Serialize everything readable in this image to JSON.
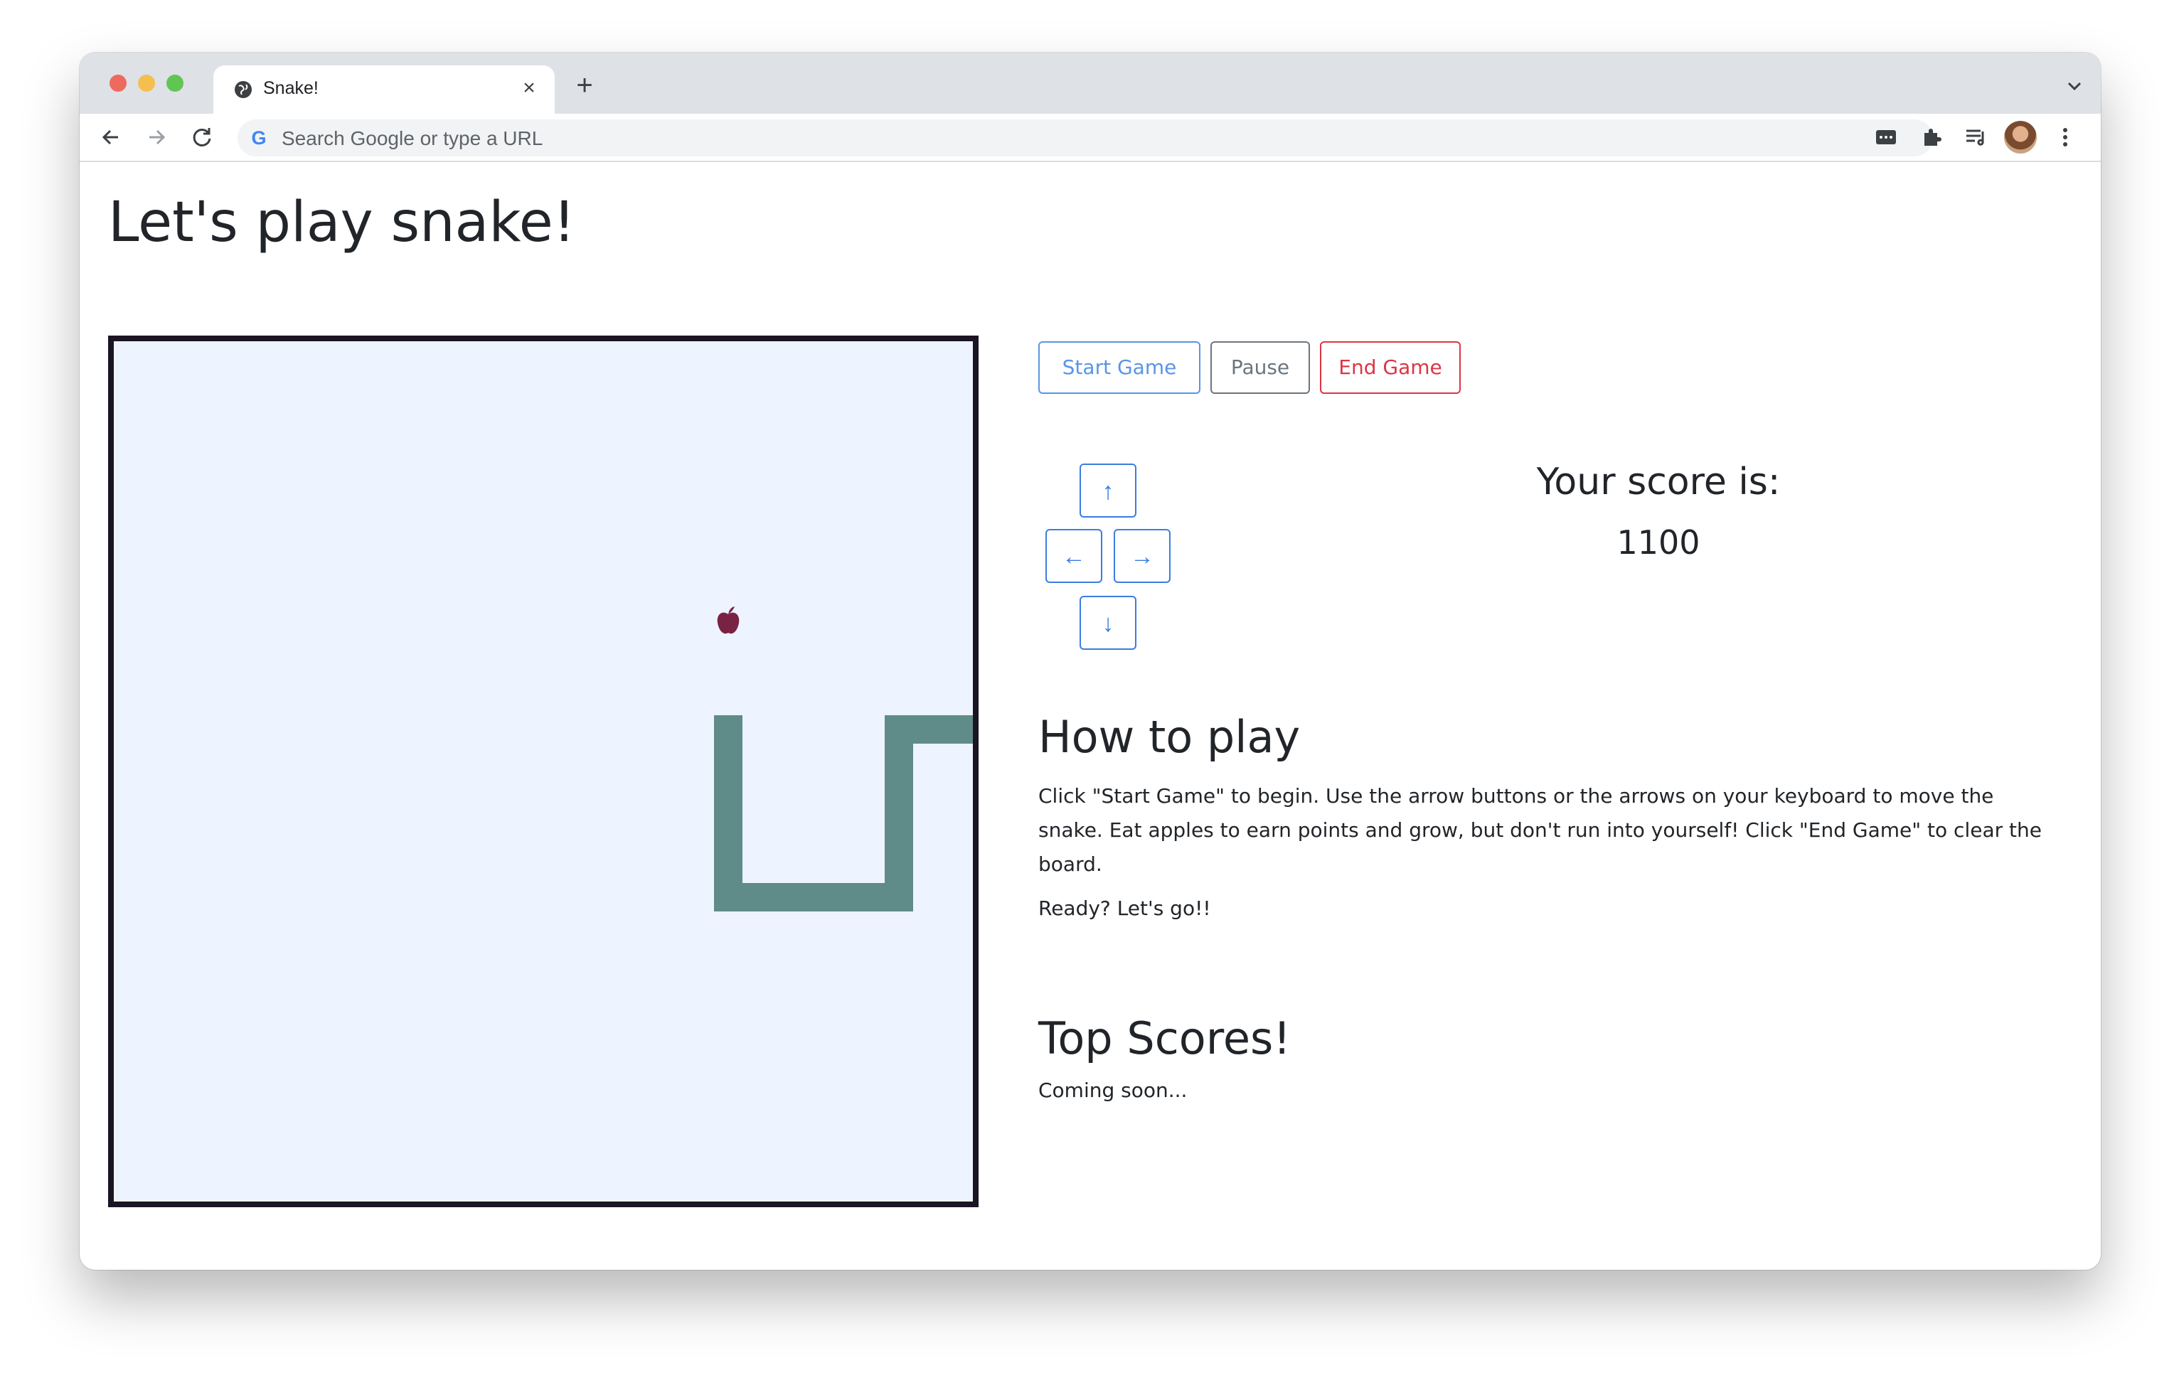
{
  "browser": {
    "tab_title": "Snake!",
    "tab_close": "×",
    "new_tab": "+",
    "address_placeholder": "Search Google or type a URL",
    "google_letter": "G",
    "icons": [
      "globe-icon",
      "close-icon",
      "plus-icon",
      "chevron-down-icon",
      "back-arrow-icon",
      "forward-arrow-icon",
      "reload-icon",
      "google-icon",
      "tab-media-icon",
      "extensions-puzzle-icon",
      "reading-list-icon",
      "profile-avatar",
      "kebab-menu-icon"
    ]
  },
  "page": {
    "title": "Let's play snake!",
    "controls": {
      "start": "Start Game",
      "pause": "Pause",
      "end": "End Game"
    },
    "arrows": {
      "up": "↑",
      "left": "←",
      "right": "→",
      "down": "↓"
    },
    "score": {
      "label": "Your score is:",
      "value": "1100"
    },
    "howto": {
      "title": "How to play",
      "body": "Click \"Start Game\" to begin. Use the arrow buttons or the arrows on your keyboard to move the snake. Eat apples to earn points and grow, but don't run into yourself! Click \"End Game\" to clear the board.",
      "ready": "Ready? Let's go!!"
    },
    "top_scores": {
      "title": "Top Scores!",
      "body": "Coming soon..."
    }
  },
  "game": {
    "board_color": "#eef4ff",
    "snake_color": "#5f8b89",
    "apple_color": "#7a2244",
    "icons": [
      "apple-icon"
    ]
  }
}
